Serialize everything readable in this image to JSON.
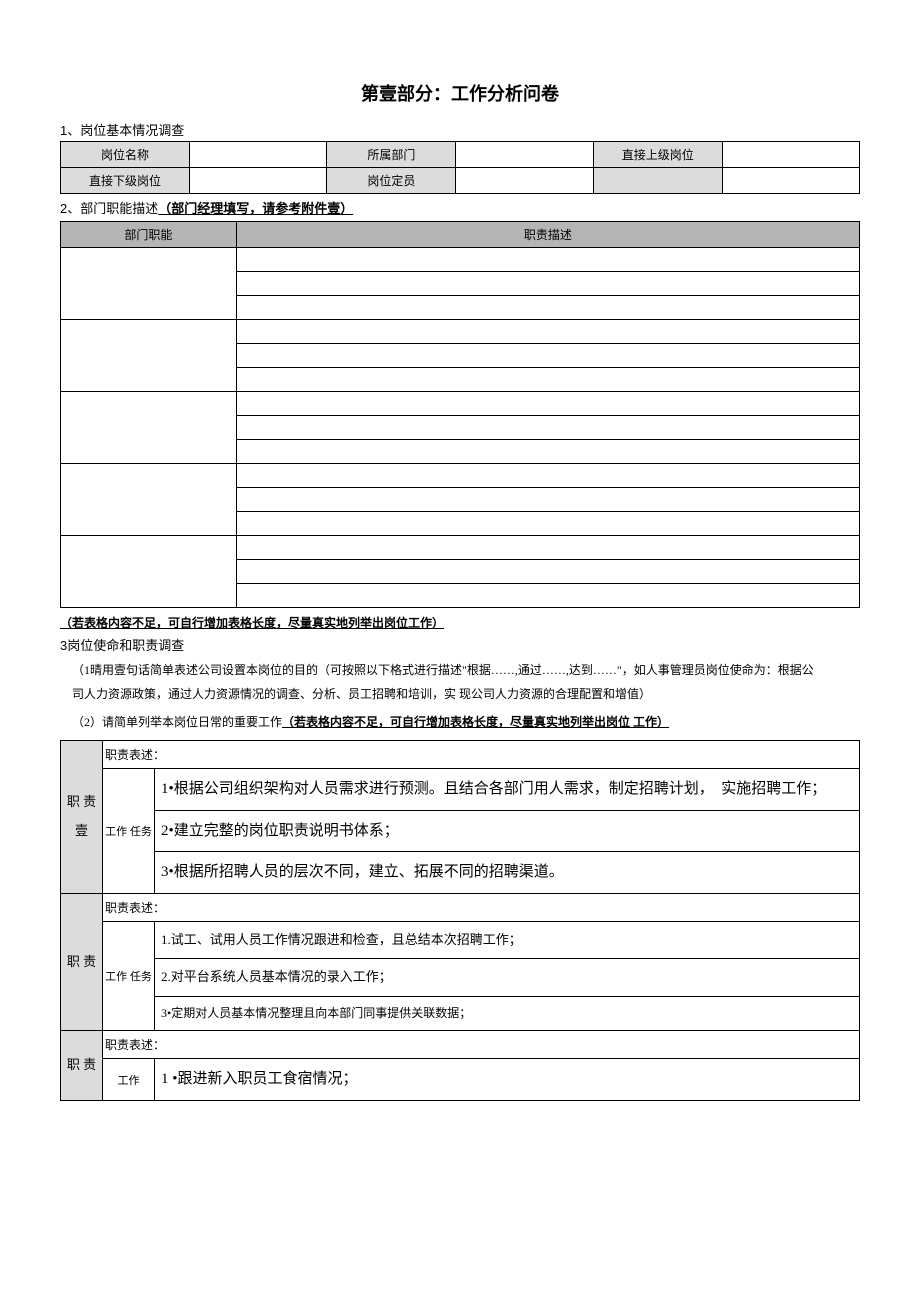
{
  "title": "第壹部分：工作分析问卷",
  "sec1": {
    "num": "1",
    "label": "、岗位基本情况调查"
  },
  "t1": {
    "r1c1": "岗位名称",
    "r1c3": "所属部门",
    "r1c5": "直接上级岗位",
    "r2c1": "直接下级岗位",
    "r2c3": "岗位定员"
  },
  "sec2": {
    "num": "2",
    "label": "、部门职能描述",
    "bold": "（部门经理填写，请参考附件壹）"
  },
  "t2": {
    "h1": "部门职能",
    "h2": "职责描述"
  },
  "note2": "（若表格内容不足，可自行增加表格长度，尽量真实地列举出岗位工作）",
  "sec3": {
    "num": "3",
    "label": "岗位使命和职责调查"
  },
  "p31a": "（1晴用壹句话简单表述公司设置本岗位的目的（可按照以下格式进行描述\"根据……,通过……,达到……\"，如人事管理员岗位使命为：根据公",
  "p31b": "司人力资源政策，通过人力资源情况的调查、分析、员工招聘和培训，实 现公司人力资源的合理配置和增值）",
  "p32a": "（2）请简单列举本岗位日常的重要工作",
  "p32b": "（若表格内容不足，可自行增加表格长度，尽量真实地列举出岗位 工作）",
  "t3": {
    "duty": "职责表述：",
    "task": "工作 任务",
    "task2": "工作",
    "side1": "职 责 壹",
    "side2": "职 责",
    "side3": "职 责",
    "b1l1": "1•根据公司组织架构对人员需求进行预测。且结合各部门用人需求，制定招聘计划，　实施招聘工作；",
    "b1l2": "2•建立完整的岗位职责说明书体系；",
    "b1l3": "3•根据所招聘人员的层次不同，建立、拓展不同的招聘渠道。",
    "b2l1": "1.试工、试用人员工作情况跟进和检查，且总结本次招聘工作；",
    "b2l2": "2.对平台系统人员基本情况的录入工作；",
    "b2l3": "3•定期对人员基本情况整理且向本部门同事提供关联数据；",
    "b3l1": "1 •跟进新入职员工食宿情况；"
  }
}
